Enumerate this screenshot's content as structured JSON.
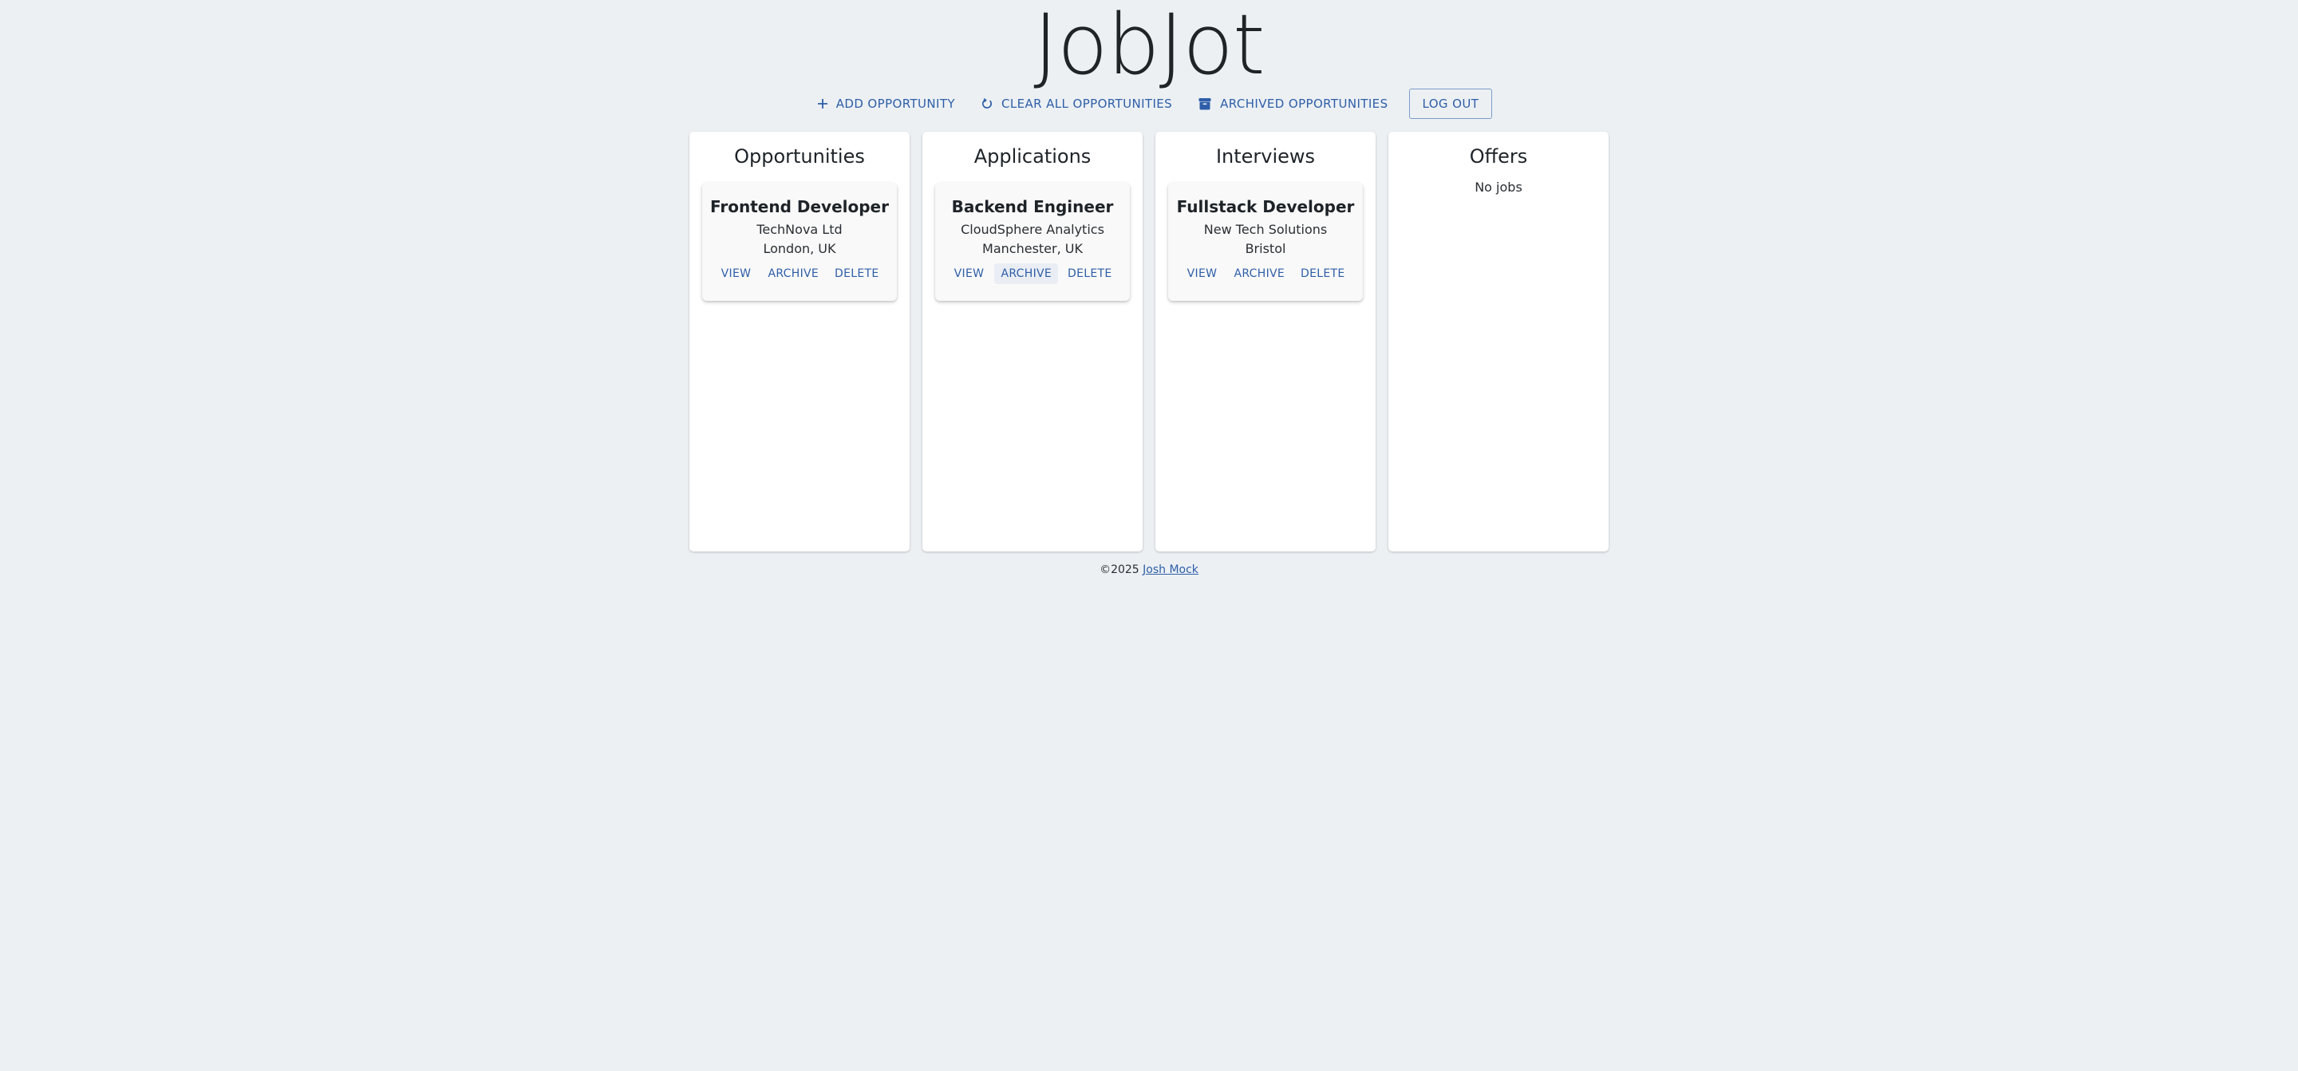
{
  "app": {
    "title": "JobJot"
  },
  "toolbar": {
    "add_label": "Add Opportunity",
    "clear_label": "Clear All Opportunities",
    "archived_label": "Archived Opportunities",
    "logout_label": "Log Out",
    "icons": {
      "add": "plus-icon",
      "clear": "refresh-icon",
      "archived": "archive-box-icon"
    },
    "accent_color": "#2e5ea8"
  },
  "columns": [
    {
      "title": "Opportunities",
      "jobs": [
        {
          "title": "Frontend Developer",
          "company": "TechNova Ltd",
          "location": "London, UK",
          "actions": [
            "View",
            "Archive",
            "Delete"
          ]
        }
      ]
    },
    {
      "title": "Applications",
      "jobs": [
        {
          "title": "Backend Engineer",
          "company": "CloudSphere Analytics",
          "location": "Manchester, UK",
          "actions": [
            "View",
            "Archive",
            "Delete"
          ]
        }
      ]
    },
    {
      "title": "Interviews",
      "jobs": [
        {
          "title": "Fullstack Developer",
          "company": "New Tech Solutions",
          "location": "Bristol",
          "actions": [
            "View",
            "Archive",
            "Delete"
          ]
        }
      ]
    },
    {
      "title": "Offers",
      "jobs": [],
      "empty_text": "No jobs"
    }
  ],
  "footer": {
    "copyright": "©2025",
    "author_link": "Josh Mock"
  },
  "colors": {
    "background": "#ecf0f3",
    "panel": "#ffffff",
    "card": "#f9f9f9",
    "link": "#2e5ea8"
  }
}
